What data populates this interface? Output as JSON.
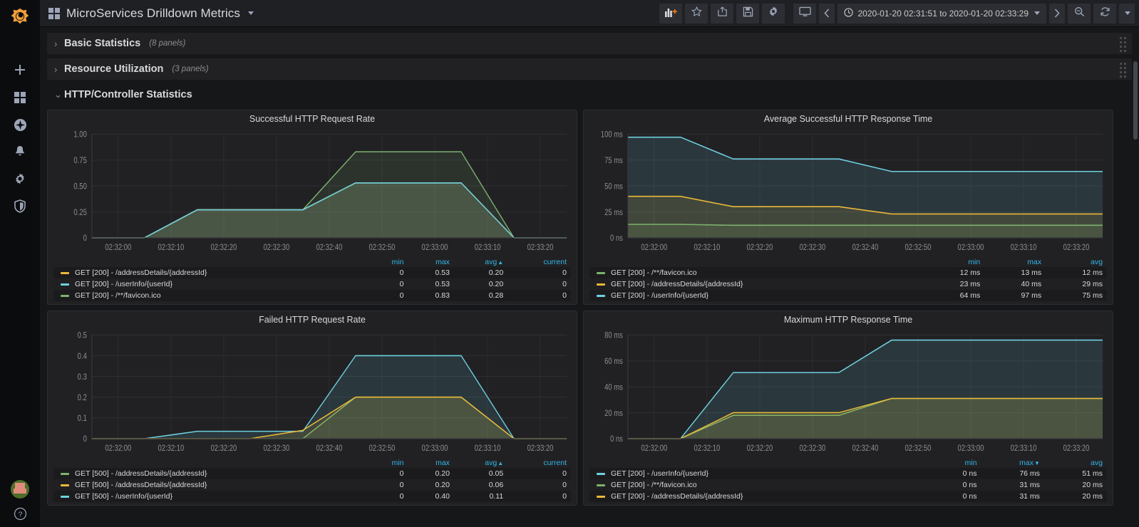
{
  "sidebar": {
    "logo_name": "grafana-logo",
    "items": [
      {
        "name": "create-add",
        "icon": "plus-icon"
      },
      {
        "name": "dashboards",
        "icon": "dashboards-grid-icon"
      },
      {
        "name": "explore",
        "icon": "compass-icon"
      },
      {
        "name": "alerting",
        "icon": "bell-icon"
      },
      {
        "name": "configuration",
        "icon": "gear-icon"
      },
      {
        "name": "server-admin",
        "icon": "shield-icon"
      }
    ],
    "bottom": [
      {
        "name": "user-avatar",
        "icon": "avatar-icon"
      },
      {
        "name": "help",
        "icon": "question-circle-icon"
      }
    ]
  },
  "topnav": {
    "dashboard_title": "MicroServices Drilldown Metrics",
    "buttons": [
      {
        "label": "add-panel",
        "icon": "add-panel-icon"
      },
      {
        "label": "mark-as-favorite",
        "icon": "star-icon"
      },
      {
        "label": "share-dashboard",
        "icon": "share-icon"
      },
      {
        "label": "save-dashboard",
        "icon": "save-icon"
      },
      {
        "label": "dashboard-settings",
        "icon": "gear-icon"
      },
      {
        "label": "cycle-view-mode",
        "icon": "tv-icon"
      }
    ],
    "time": {
      "range_text": "2020-01-20 02:31:51 to 2020-01-20 02:33:29",
      "clock_icon": "clock-icon",
      "prev_label": "‹",
      "next_label": "›",
      "zoom_out_icon": "zoom-out-icon",
      "refresh_icon": "refresh-icon",
      "refresh_dropdown_icon": "chevron-down-icon"
    }
  },
  "rows": [
    {
      "title": "Basic Statistics",
      "count": "(8 panels)",
      "collapsed": true,
      "chevron": "›"
    },
    {
      "title": "Resource Utilization",
      "count": "(3 panels)",
      "collapsed": true,
      "chevron": "›"
    },
    {
      "title": "HTTP/Controller Statistics",
      "count": "",
      "collapsed": false,
      "chevron": "⌄"
    }
  ],
  "colors": {
    "green": "#7eb26d",
    "yellow": "#eab839",
    "cyan": "#6ed0e0",
    "legend_header": "#33b5e5",
    "panel_bg": "#212124",
    "page_bg": "#161719"
  },
  "chart_data": [
    {
      "type": "area",
      "title": "Successful HTTP Request Rate",
      "xlabel": "",
      "ylabel": "",
      "ylim": [
        0,
        1.0
      ],
      "yticks": [
        "0",
        "0.25",
        "0.50",
        "0.75",
        "1.00"
      ],
      "xticks": [
        "02:32:00",
        "02:32:10",
        "02:32:20",
        "02:32:30",
        "02:32:40",
        "02:32:50",
        "02:33:00",
        "02:33:10",
        "02:33:20"
      ],
      "grid": true,
      "legend_position": "bottom-table",
      "legend_columns": [
        "min",
        "max",
        "avg",
        "current"
      ],
      "legend_sort": "avg",
      "legend_sort_dir": "asc",
      "series": [
        {
          "name": "GET [200] - /addressDetails/{addressId}",
          "color": "#eab839",
          "min": "0",
          "max": "0.53",
          "avg": "0.20",
          "current": "0",
          "values": [
            0,
            0,
            0.27,
            0.27,
            0.27,
            0.53,
            0.53,
            0.53,
            0,
            0
          ]
        },
        {
          "name": "GET [200] - /userInfo/{userId}",
          "color": "#6ed0e0",
          "min": "0",
          "max": "0.53",
          "avg": "0.20",
          "current": "0",
          "values": [
            0,
            0,
            0.27,
            0.27,
            0.27,
            0.53,
            0.53,
            0.53,
            0,
            0
          ]
        },
        {
          "name": "GET [200] - /**/favicon.ico",
          "color": "#7eb26d",
          "min": "0",
          "max": "0.83",
          "avg": "0.28",
          "current": "0",
          "values": [
            0,
            0,
            0.27,
            0.27,
            0.27,
            0.83,
            0.83,
            0.83,
            0,
            0
          ]
        }
      ]
    },
    {
      "type": "area",
      "title": "Average Successful HTTP Response Time",
      "xlabel": "",
      "ylabel": "",
      "ylim": [
        0,
        100
      ],
      "yticks": [
        "0 ns",
        "25 ms",
        "50 ms",
        "75 ms",
        "100 ms"
      ],
      "xticks": [
        "02:32:00",
        "02:32:10",
        "02:32:20",
        "02:32:30",
        "02:32:40",
        "02:32:50",
        "02:33:00",
        "02:33:10",
        "02:33:20"
      ],
      "grid": true,
      "legend_position": "bottom-table",
      "legend_columns": [
        "min",
        "max",
        "avg"
      ],
      "legend_sort": "none",
      "legend_sort_dir": "",
      "series": [
        {
          "name": "GET [200] - /**/favicon.ico",
          "color": "#7eb26d",
          "min": "12 ms",
          "max": "13 ms",
          "avg": "12 ms",
          "values": [
            13,
            13,
            12,
            12,
            12,
            12,
            12,
            12,
            12,
            12
          ]
        },
        {
          "name": "GET [200] - /addressDetails/{addressId}",
          "color": "#eab839",
          "min": "23 ms",
          "max": "40 ms",
          "avg": "29 ms",
          "values": [
            40,
            40,
            30,
            30,
            30,
            23,
            23,
            23,
            23,
            23
          ]
        },
        {
          "name": "GET [200] - /userInfo/{userId}",
          "color": "#6ed0e0",
          "min": "64 ms",
          "max": "97 ms",
          "avg": "75 ms",
          "values": [
            97,
            97,
            76,
            76,
            76,
            64,
            64,
            64,
            64,
            64
          ]
        }
      ]
    },
    {
      "type": "area",
      "title": "Failed HTTP Request Rate",
      "xlabel": "",
      "ylabel": "",
      "ylim": [
        0,
        0.5
      ],
      "yticks": [
        "0",
        "0.1",
        "0.2",
        "0.3",
        "0.4",
        "0.5"
      ],
      "xticks": [
        "02:32:00",
        "02:32:10",
        "02:32:20",
        "02:32:30",
        "02:32:40",
        "02:32:50",
        "02:33:00",
        "02:33:10",
        "02:33:20"
      ],
      "grid": true,
      "legend_position": "bottom-table",
      "legend_columns": [
        "min",
        "max",
        "avg",
        "current"
      ],
      "legend_sort": "avg",
      "legend_sort_dir": "asc",
      "series": [
        {
          "name": "GET [500] - /addressDetails/{addressId}",
          "color": "#7eb26d",
          "min": "0",
          "max": "0.20",
          "avg": "0.05",
          "current": "0",
          "values": [
            0,
            0,
            0.0,
            0.0,
            0.0,
            0.2,
            0.2,
            0.2,
            0,
            0
          ]
        },
        {
          "name": "GET [500] - /addressDetails/{addressId}",
          "color": "#eab839",
          "min": "0",
          "max": "0.20",
          "avg": "0.06",
          "current": "0",
          "values": [
            0,
            0,
            0.0,
            0.0,
            0.04,
            0.2,
            0.2,
            0.2,
            0,
            0
          ]
        },
        {
          "name": "GET [500] - /userInfo/{userId}",
          "color": "#6ed0e0",
          "min": "0",
          "max": "0.40",
          "avg": "0.11",
          "current": "0",
          "values": [
            0,
            0,
            0.035,
            0.035,
            0.035,
            0.4,
            0.4,
            0.4,
            0,
            0
          ]
        }
      ]
    },
    {
      "type": "area",
      "title": "Maximum HTTP Response Time",
      "xlabel": "",
      "ylabel": "",
      "ylim": [
        0,
        80
      ],
      "yticks": [
        "0 ns",
        "20 ms",
        "40 ms",
        "60 ms",
        "80 ms"
      ],
      "xticks": [
        "02:32:00",
        "02:32:10",
        "02:32:20",
        "02:32:30",
        "02:32:40",
        "02:32:50",
        "02:33:00",
        "02:33:10",
        "02:33:20"
      ],
      "grid": true,
      "legend_position": "bottom-table",
      "legend_columns": [
        "min",
        "max",
        "avg"
      ],
      "legend_sort": "max",
      "legend_sort_dir": "desc",
      "series": [
        {
          "name": "GET [200] - /userInfo/{userId}",
          "color": "#6ed0e0",
          "min": "0 ns",
          "max": "76 ms",
          "avg": "51 ms",
          "values": [
            0,
            0,
            51,
            51,
            51,
            76,
            76,
            76,
            76,
            76
          ]
        },
        {
          "name": "GET [200] - /**/favicon.ico",
          "color": "#7eb26d",
          "min": "0 ns",
          "max": "31 ms",
          "avg": "20 ms",
          "values": [
            0,
            0,
            18,
            18,
            18,
            31,
            31,
            31,
            31,
            31
          ]
        },
        {
          "name": "GET [200] - /addressDetails/{addressId}",
          "color": "#eab839",
          "min": "0 ns",
          "max": "31 ms",
          "avg": "20 ms",
          "values": [
            0,
            0,
            20,
            20,
            20,
            31,
            31,
            31,
            31,
            31
          ]
        }
      ]
    }
  ]
}
